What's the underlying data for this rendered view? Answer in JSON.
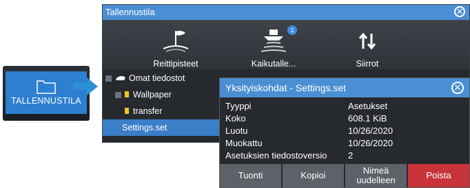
{
  "launcher": {
    "label": "TALLENNUSTILA"
  },
  "dialog": {
    "title": "Tallennustila",
    "toolbar": [
      {
        "label": "Reittipisteet",
        "icon": "waypoint-flag-icon"
      },
      {
        "label": "Kaikutalle...",
        "icon": "echo-recording-icon",
        "badge": "1"
      },
      {
        "label": "Siirrot",
        "icon": "transfer-arrows-icon"
      }
    ],
    "tree": [
      {
        "label": "Omat tiedostot"
      },
      {
        "label": "Wallpaper"
      },
      {
        "label": "transfer"
      },
      {
        "label": "Settings.set"
      }
    ]
  },
  "details": {
    "title": "Yksityiskohdat - Settings.set",
    "rows": [
      {
        "key": "Tyyppi",
        "value": "Asetukset"
      },
      {
        "key": "Koko",
        "value": "608.1 KiB"
      },
      {
        "key": "Luotu",
        "value": "10/26/2020"
      },
      {
        "key": "Muokattu",
        "value": "10/26/2020"
      },
      {
        "key": "Asetuksien tiedostoversio",
        "value": "2"
      }
    ],
    "buttons": {
      "import": "Tuonti",
      "copy": "Kopioi",
      "rename_line1": "Nimeä",
      "rename_line2": "uudelleen",
      "delete": "Poista"
    }
  },
  "colors": {
    "accent": "#4a8fd3",
    "danger": "#c8333a",
    "folder": "#f0c623"
  }
}
